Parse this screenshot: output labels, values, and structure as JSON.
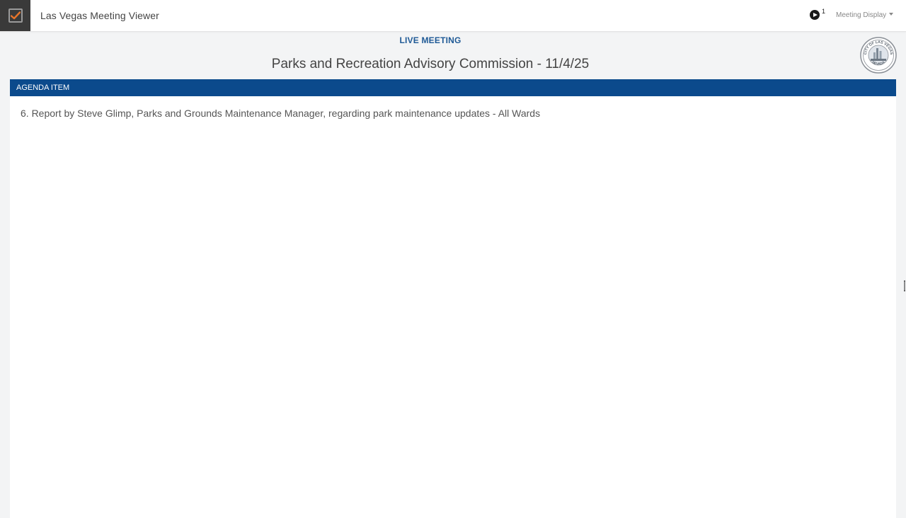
{
  "header": {
    "app_title": "Las Vegas Meeting Viewer",
    "live_count": "1",
    "display_menu_label": "Meeting Display",
    "logo_icon": "check-box-icon",
    "live_icon": "play-circle-icon"
  },
  "meeting": {
    "status_label": "LIVE MEETING",
    "title": "Parks and Recreation Advisory Commission - 11/4/25",
    "seal_text_top": "CITY OF LAS VEGAS",
    "seal_text_bottom": "NEVADA"
  },
  "agenda": {
    "header_label": "AGENDA ITEM",
    "item_text": "6. Report by Steve Glimp, Parks and Grounds Maintenance Manager, regarding park maintenance updates - All Wards"
  },
  "colors": {
    "accent_blue": "#0b4a8c",
    "live_label_blue": "#1f5a96",
    "logo_check_orange": "#e8742a",
    "logo_bg": "#3a3a3a"
  }
}
